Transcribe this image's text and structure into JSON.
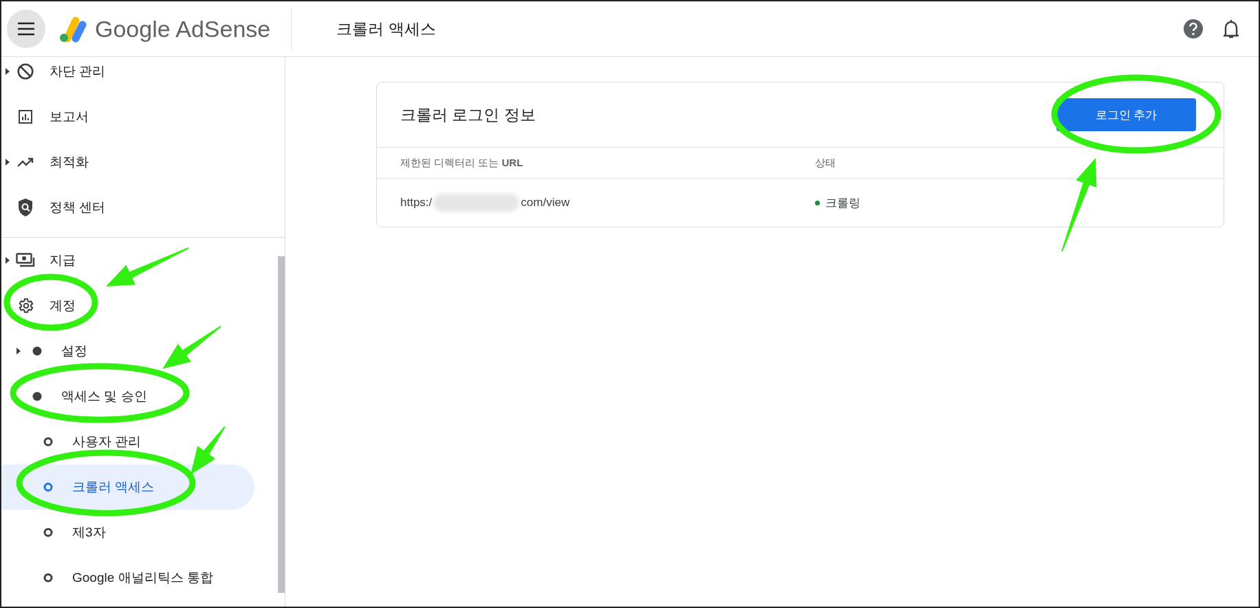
{
  "header": {
    "product": "Google AdSense",
    "page_title": "크롤러 액세스"
  },
  "sidebar": {
    "sections": [
      [
        {
          "label": "차단 관리",
          "kind": "block",
          "expandable": true,
          "selected": false
        },
        {
          "label": "보고서",
          "kind": "report",
          "expandable": false,
          "selected": false
        },
        {
          "label": "최적화",
          "kind": "trending",
          "expandable": true,
          "selected": false
        },
        {
          "label": "정책 센터",
          "kind": "shield",
          "expandable": false,
          "selected": false
        }
      ],
      [
        {
          "label": "지급",
          "kind": "payments",
          "expandable": true,
          "selected": false
        },
        {
          "label": "계정",
          "kind": "gear",
          "expandable": false,
          "selected": false,
          "children": [
            {
              "label": "설정",
              "expandable": true,
              "selected": false
            },
            {
              "label": "액세스 및 승인",
              "expandable": false,
              "selected": false,
              "children": [
                {
                  "label": "사용자 관리",
                  "selected": false
                },
                {
                  "label": "크롤러 액세스",
                  "selected": true
                },
                {
                  "label": "제3자",
                  "selected": false
                },
                {
                  "label": "Google 애널리틱스 통합",
                  "selected": false
                }
              ]
            }
          ]
        }
      ]
    ]
  },
  "card": {
    "title": "크롤러 로그인 정보",
    "button": "로그인 추가",
    "columns": [
      "제한된 디렉터리 또는 **URL**",
      "상태"
    ],
    "rows": [
      {
        "url_start": "https:/",
        "redacted": true,
        "url_end": "com/view",
        "status": "크롤링",
        "color": "#1e8e3e"
      }
    ]
  },
  "annotations": [
    {
      "kind": "ellipse"
    },
    {
      "kind": "arrow"
    },
    {
      "kind": "arrow"
    },
    {
      "kind": "ellipse"
    },
    {
      "kind": "arrow"
    },
    {
      "kind": "ellipse"
    },
    {
      "kind": "ellipse"
    },
    {
      "kind": "arrow"
    }
  ]
}
